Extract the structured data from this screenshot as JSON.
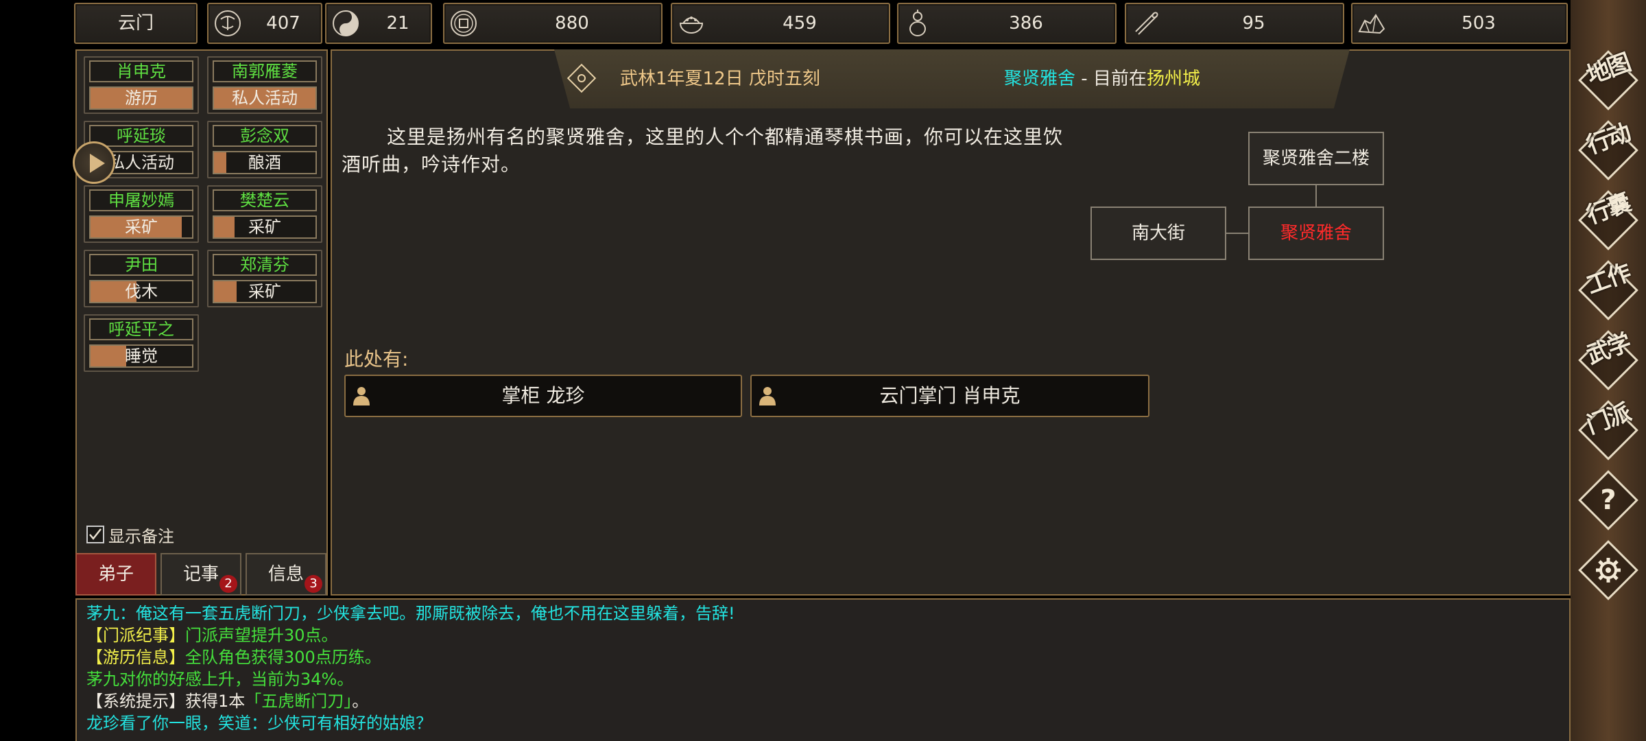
{
  "topbar": {
    "sect_name": "云门",
    "resources": [
      {
        "icon": "reputation-icon",
        "value": "407"
      },
      {
        "icon": "yin-yang-icon",
        "value": "21"
      },
      {
        "icon": "coin-icon",
        "value": "880"
      },
      {
        "icon": "food-bowl-icon",
        "value": "459"
      },
      {
        "icon": "wine-gourd-icon",
        "value": "386"
      },
      {
        "icon": "wood-log-icon",
        "value": "95"
      },
      {
        "icon": "ore-icon",
        "value": "503"
      }
    ]
  },
  "disciples": [
    {
      "name": "肖申克",
      "activity": "游历",
      "progress": 1.0
    },
    {
      "name": "南郭雁菱",
      "activity": "私人活动",
      "progress": 1.0
    },
    {
      "name": "呼延琰",
      "activity": "私人活动",
      "progress": 0.1
    },
    {
      "name": "彭念双",
      "activity": "酿酒",
      "progress": 0.12
    },
    {
      "name": "申屠妙嫣",
      "activity": "采矿",
      "progress": 0.9
    },
    {
      "name": "樊楚云",
      "activity": "采矿",
      "progress": 0.2
    },
    {
      "name": "尹田",
      "activity": "伐木",
      "progress": 0.45
    },
    {
      "name": "郑清芬",
      "activity": "采矿",
      "progress": 0.22
    },
    {
      "name": "呼延平之",
      "activity": "睡觉",
      "progress": 0.35
    }
  ],
  "show_notes_label": "显示备注",
  "tabs": [
    {
      "label": "弟子",
      "badge": ""
    },
    {
      "label": "记事",
      "badge": "2"
    },
    {
      "label": "信息",
      "badge": "3"
    }
  ],
  "header": {
    "date": "武林1年夏12日 戊时五刻",
    "location": "聚贤雅舍",
    "separator": "-",
    "current_prefix": "目前在",
    "city": "扬州城"
  },
  "description": "这里是扬州有名的聚贤雅舍，这里的人个个都精通琴棋书画，你可以在这里饮酒听曲，吟诗作对。",
  "map": {
    "upstairs": "聚贤雅舍二楼",
    "west": "南大街",
    "current": "聚贤雅舍"
  },
  "here_label": "此处有:",
  "npcs": [
    {
      "name": "掌柜 龙珍"
    },
    {
      "name": "云门掌门 肖申克"
    }
  ],
  "log": [
    {
      "text": "茅九：俺这有一套五虎断门刀，少侠拿去吧。那厮既被除去，俺也不用在这里躲着，告辞!"
    },
    {
      "tag": "【门派纪事】",
      "text": "门派声望提升30点。"
    },
    {
      "tag": "【游历信息】",
      "text": "全队角色获得300点历练。"
    },
    {
      "text": "茅九对你的好感上升，当前为34%。"
    },
    {
      "tag": "【系统提示】",
      "text": "获得1本",
      "item": "「五虎断门刀」",
      "end": "。"
    },
    {
      "text": "龙珍看了你一眼，笑道：少侠可有相好的姑娘？"
    }
  ],
  "menu": [
    "地图",
    "行动",
    "行囊",
    "工作",
    "武学",
    "门派",
    "?",
    "settings"
  ],
  "colors": {
    "frame": "#8a6d42",
    "name_green": "#5fe042",
    "cyan": "#23e3e0",
    "yellow": "#f3f04a",
    "current_room_red": "#ff2a2a",
    "progress": "#b8774a"
  }
}
